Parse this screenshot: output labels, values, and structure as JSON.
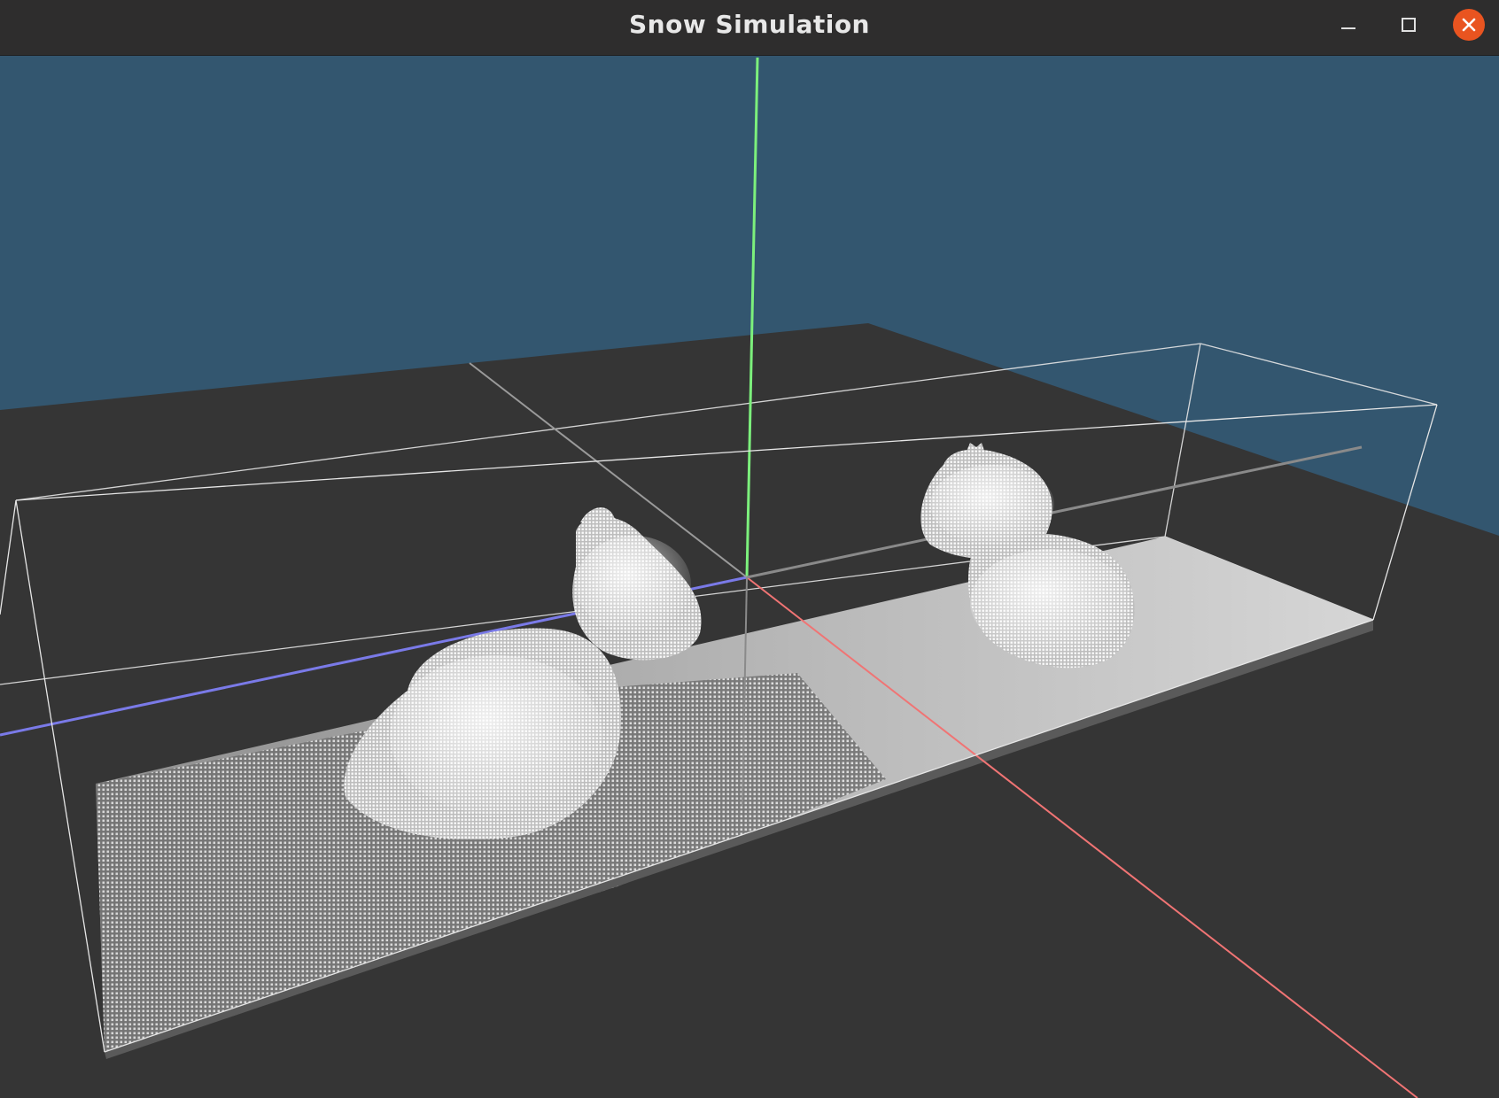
{
  "window": {
    "title": "Snow Simulation",
    "controls": {
      "minimize_icon": "minimize-icon",
      "maximize_icon": "maximize-icon",
      "close_icon": "close-icon"
    }
  },
  "scene": {
    "sky_color": "#33566f",
    "ground_color": "#353535",
    "axis_x_color": "#f07474",
    "axis_y_color": "#7cf07c",
    "axis_z_color": "#7a7ae8",
    "bounding_box_color": "#e6e6e6",
    "snow_color": "#f2f2f2"
  }
}
